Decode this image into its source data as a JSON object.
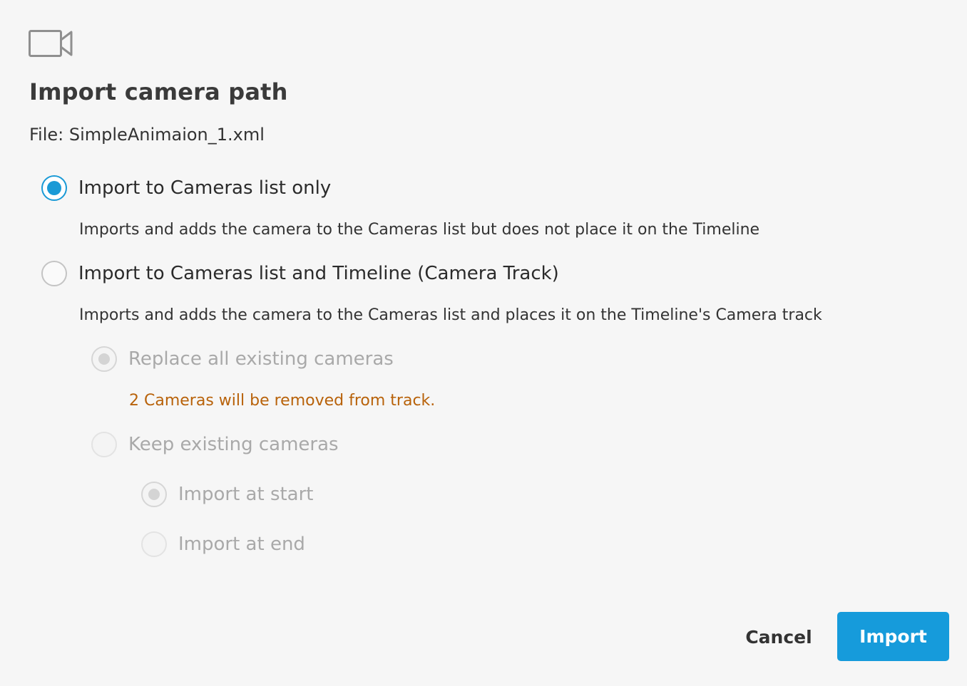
{
  "dialog": {
    "icon": "video-camera-icon",
    "title": "Import camera path",
    "file_label": "File: SimpleAnimaion_1.xml"
  },
  "options": {
    "cameras_list_only": {
      "label": "Import to Cameras list only",
      "description": "Imports and adds the camera to the Cameras list but does not place it on the Timeline",
      "checked": true,
      "enabled": true
    },
    "cameras_list_and_timeline": {
      "label": "Import to Cameras list and Timeline (Camera Track)",
      "description": "Imports and adds the camera to the Cameras list and places it on the Timeline's Camera track",
      "checked": false,
      "enabled": true
    },
    "replace_all": {
      "label": "Replace all existing cameras",
      "warning": "2 Cameras will be removed from track.",
      "checked": true,
      "enabled": false
    },
    "keep_existing": {
      "label": "Keep existing cameras",
      "checked": false,
      "enabled": false
    },
    "import_at_start": {
      "label": "Import at start",
      "checked": true,
      "enabled": false
    },
    "import_at_end": {
      "label": "Import at end",
      "checked": false,
      "enabled": false
    }
  },
  "buttons": {
    "cancel_label": "Cancel",
    "import_label": "Import"
  },
  "colors": {
    "accent": "#169bdb",
    "warning": "#b8620a",
    "background": "#f6f6f6",
    "disabled_text": "#a9a9a9"
  }
}
